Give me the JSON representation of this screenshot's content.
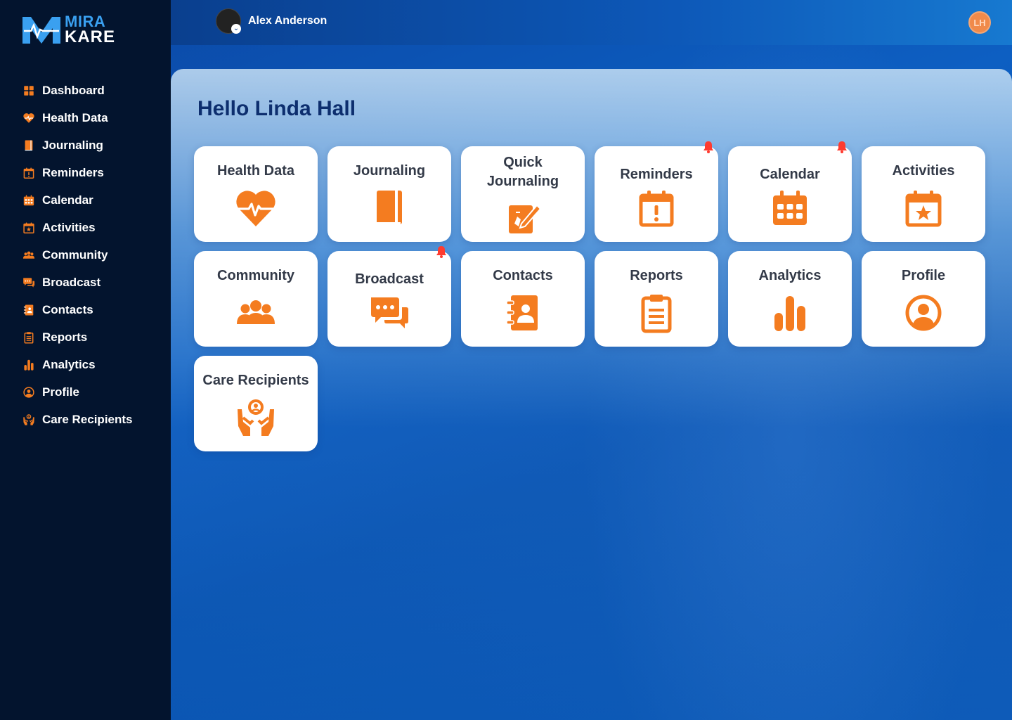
{
  "brand": {
    "line1": "MIRA",
    "line2": "KARE"
  },
  "sidebar": {
    "items": [
      {
        "label": "Dashboard",
        "icon": "grid-icon"
      },
      {
        "label": "Health Data",
        "icon": "heart-icon"
      },
      {
        "label": "Journaling",
        "icon": "book-icon"
      },
      {
        "label": "Reminders",
        "icon": "calendar-alert-icon"
      },
      {
        "label": "Calendar",
        "icon": "calendar-icon"
      },
      {
        "label": "Activities",
        "icon": "calendar-star-icon"
      },
      {
        "label": "Community",
        "icon": "people-icon"
      },
      {
        "label": "Broadcast",
        "icon": "chat-icon"
      },
      {
        "label": "Contacts",
        "icon": "contact-book-icon"
      },
      {
        "label": "Reports",
        "icon": "clipboard-icon"
      },
      {
        "label": "Analytics",
        "icon": "bar-chart-icon"
      },
      {
        "label": "Profile",
        "icon": "user-circle-icon"
      },
      {
        "label": "Care Recipients",
        "icon": "care-hands-icon"
      }
    ]
  },
  "header": {
    "user_name": "Alex Anderson",
    "initials": "LH"
  },
  "main": {
    "greeting": "Hello Linda Hall",
    "tiles": [
      {
        "line1": "Health Data",
        "line2": "",
        "icon": "heart-pulse-icon",
        "notify": false
      },
      {
        "line1": "Journaling",
        "line2": "",
        "icon": "book-icon",
        "notify": false
      },
      {
        "line1": "Quick",
        "line2": "Journaling",
        "icon": "quick-journal-icon",
        "notify": false
      },
      {
        "line1": "Reminders",
        "line2": "",
        "icon": "calendar-alert-icon",
        "notify": true
      },
      {
        "line1": "Calendar",
        "line2": "",
        "icon": "calendar-icon",
        "notify": true
      },
      {
        "line1": "Activities",
        "line2": "",
        "icon": "calendar-star-icon",
        "notify": false
      },
      {
        "line1": "Community",
        "line2": "",
        "icon": "people-icon",
        "notify": false
      },
      {
        "line1": "Broadcast",
        "line2": "",
        "icon": "chat-icon",
        "notify": true
      },
      {
        "line1": "Contacts",
        "line2": "",
        "icon": "contact-book-icon",
        "notify": false
      },
      {
        "line1": "Reports",
        "line2": "",
        "icon": "clipboard-icon",
        "notify": false
      },
      {
        "line1": "Analytics",
        "line2": "",
        "icon": "bar-chart-icon",
        "notify": false
      },
      {
        "line1": "Profile",
        "line2": "",
        "icon": "user-circle-icon",
        "notify": false
      },
      {
        "line1": "Care Recipients",
        "line2": "",
        "icon": "care-hands-icon",
        "notify": false
      }
    ]
  },
  "colors": {
    "accent": "#f47c20",
    "sidebar_bg": "#03142e",
    "notify": "#ff3b2f"
  }
}
